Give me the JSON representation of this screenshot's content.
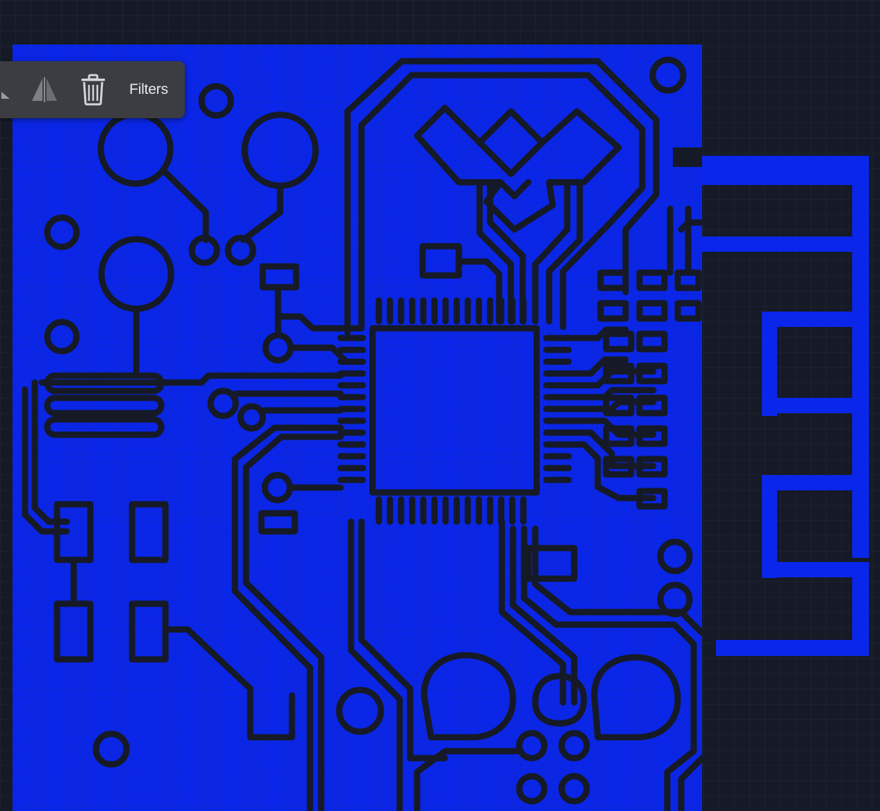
{
  "toolbar": {
    "filters_label": "Filters",
    "icons": [
      "flip-vertical-icon",
      "flip-horizontal-icon",
      "trash-icon"
    ]
  },
  "colors": {
    "background": "#151a26",
    "grid": "#222a36",
    "copper": "#0a26eb",
    "clearance": "#151a26",
    "toolbar": "#3b3d42",
    "toolbar_text": "#e9e9ea"
  }
}
